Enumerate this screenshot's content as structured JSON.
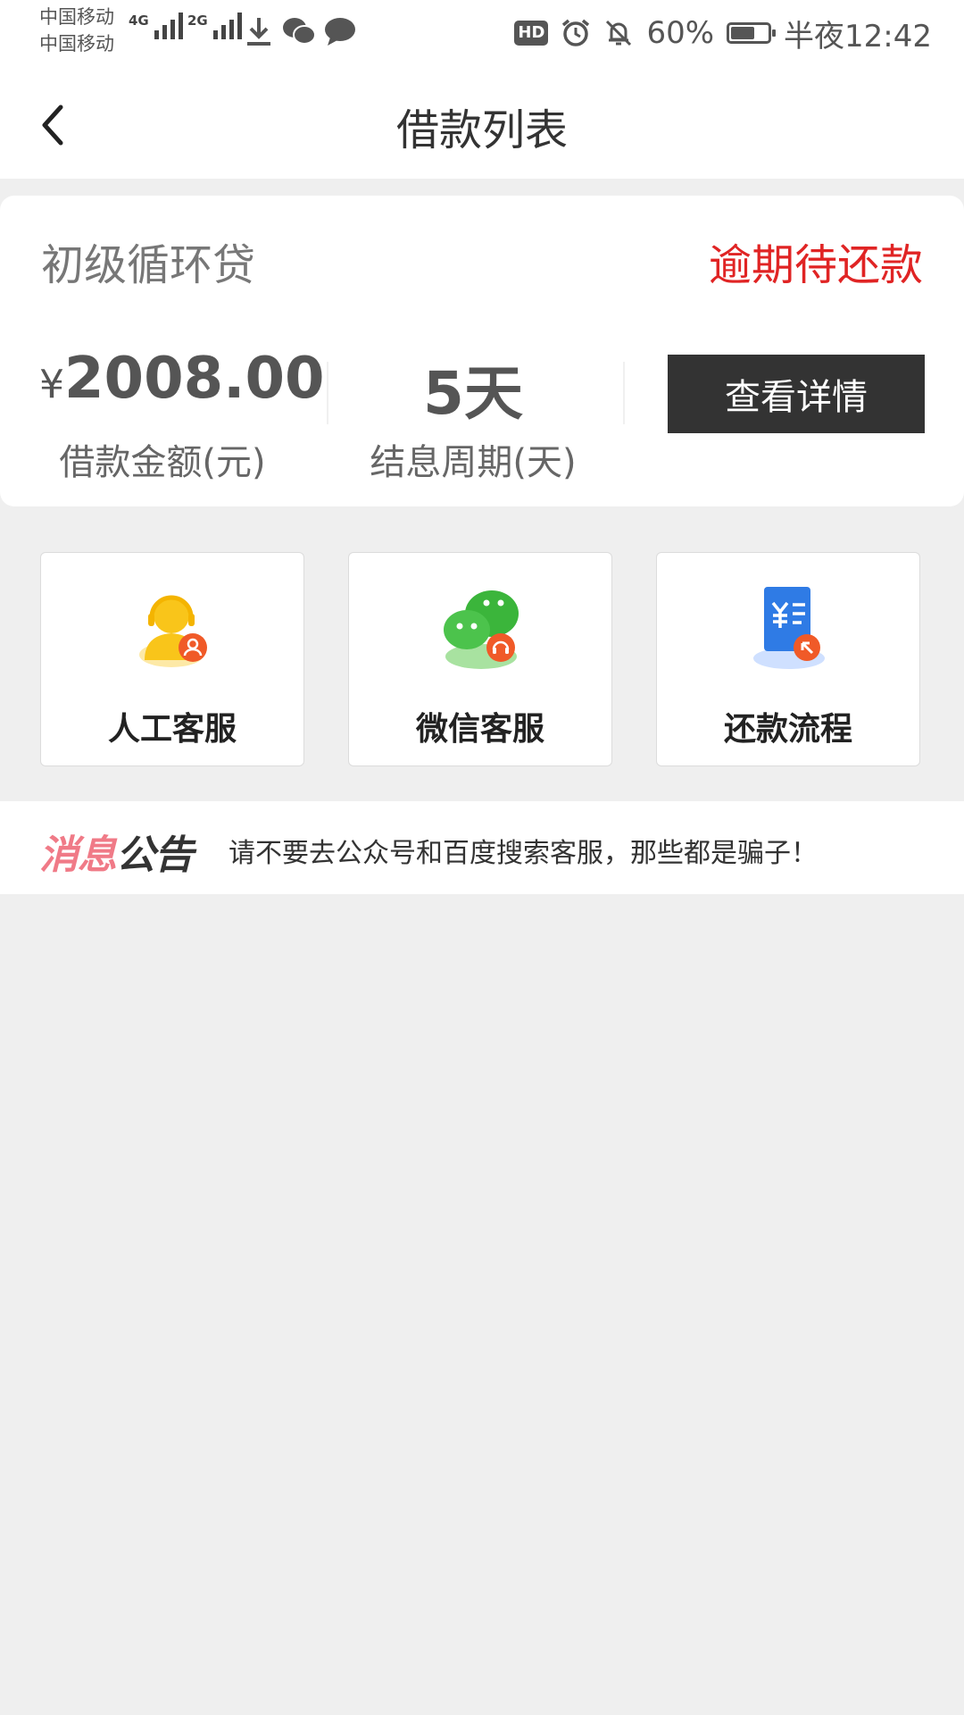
{
  "status_bar": {
    "carrier_1": "中国移动",
    "carrier_2": "中国移动",
    "net_1": "4G",
    "net_2": "2G",
    "hd": "HD",
    "battery_percent": "60%",
    "battery_level": 0.6,
    "time": "半夜12:42"
  },
  "header": {
    "title": "借款列表"
  },
  "loan": {
    "product_name": "初级循环贷",
    "status": "逾期待还款",
    "currency_symbol": "¥",
    "amount": "2008.00",
    "amount_label": "借款金额(元)",
    "period": "5天",
    "period_label": "结息周期(天)",
    "detail_button": "查看详情"
  },
  "services": [
    {
      "label": "人工客服",
      "icon": "customer-service-icon"
    },
    {
      "label": "微信客服",
      "icon": "wechat-service-icon"
    },
    {
      "label": "还款流程",
      "icon": "repayment-process-icon"
    }
  ],
  "notice": {
    "logo_part1": "消息",
    "logo_part2": "公告",
    "text": "请不要去公众号和百度搜索客服，那些都是骗子！"
  },
  "colors": {
    "status_red": "#e02424",
    "button_dark": "#333333",
    "background": "#efefef"
  }
}
